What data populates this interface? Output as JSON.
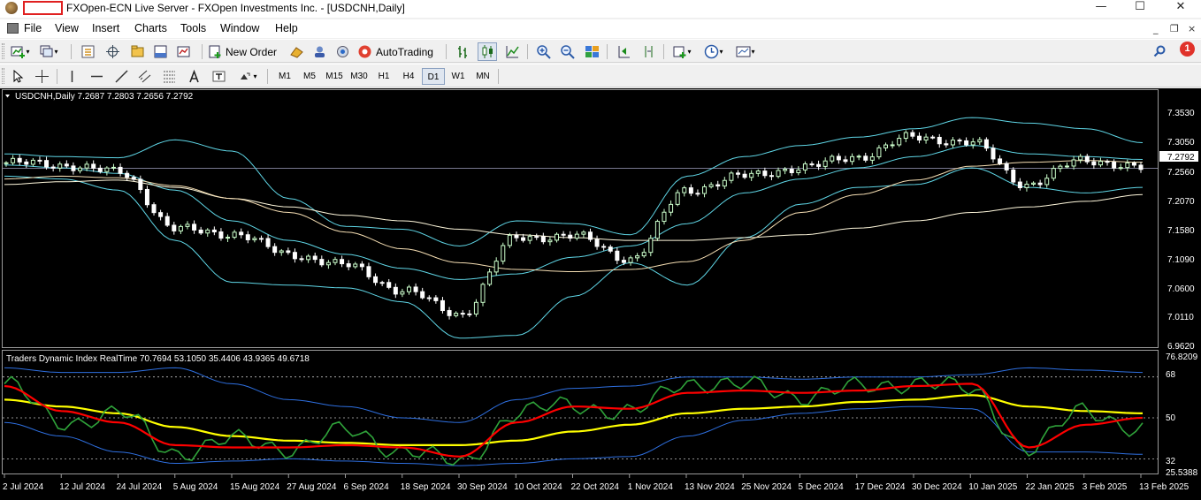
{
  "titlebar": {
    "title": "FXOpen-ECN Live Server - FXOpen Investments Inc. - [USDCNH,Daily]",
    "minimize": "—",
    "maximize": "☐",
    "close": "✕"
  },
  "menu": {
    "items": [
      "File",
      "View",
      "Insert",
      "Charts",
      "Tools",
      "Window",
      "Help"
    ],
    "mdi_minimize": "_",
    "mdi_restore": "❐",
    "mdi_close": "×"
  },
  "toolbar": {
    "new_order": "New Order",
    "auto_trading": "AutoTrading",
    "notification_count": "1"
  },
  "timeframes": [
    "M1",
    "M5",
    "M15",
    "M30",
    "H1",
    "H4",
    "D1",
    "W1",
    "MN"
  ],
  "active_timeframe": "D1",
  "colors": {
    "background": "#000000",
    "bull_candle": "#ccffcc",
    "bear_candle": "#ffffff",
    "bollinger": "#5fd6e6",
    "ma_long": "#fff8dc",
    "ma_mid": "#f5deb3",
    "tdi_green": "#2fa33a",
    "tdi_red": "#ff0000",
    "tdi_yellow": "#ffff00",
    "tdi_band": "#2e6fe0",
    "grid_level": "#bfbfbf"
  },
  "main_chart": {
    "header": "USDCNH,Daily  7.2687 7.2803 7.2656 7.2792",
    "current_price": "7.2792",
    "y_ticks": [
      "7.3530",
      "7.3050",
      "7.2560",
      "7.2070",
      "7.1580",
      "7.1090",
      "7.0600",
      "7.0110",
      "6.9620"
    ]
  },
  "indicator": {
    "header": "Traders Dynamic Index RealTime 70.7694 53.1050 35.4406 43.9365 49.6718",
    "y_ticks": [
      "76.8209",
      "68",
      "50",
      "32",
      "25.5388"
    ]
  },
  "x_axis": {
    "labels": [
      "2 Jul 2024",
      "12 Jul 2024",
      "24 Jul 2024",
      "5 Aug 2024",
      "15 Aug 2024",
      "27 Aug 2024",
      "6 Sep 2024",
      "18 Sep 2024",
      "30 Sep 2024",
      "10 Oct 2024",
      "22 Oct 2024",
      "1 Nov 2024",
      "13 Nov 2024",
      "25 Nov 2024",
      "5 Dec 2024",
      "17 Dec 2024",
      "30 Dec 2024",
      "10 Jan 2025",
      "22 Jan 2025",
      "3 Feb 2025",
      "13 Feb 2025"
    ]
  },
  "chart_data": [
    {
      "type": "candlestick",
      "title": "USDCNH,Daily",
      "ylim": [
        6.962,
        7.378
      ],
      "y_ticks": [
        7.353,
        7.305,
        7.256,
        7.207,
        7.158,
        7.109,
        7.06,
        7.011,
        6.962
      ],
      "last": {
        "open": 7.2687,
        "high": 7.2803,
        "low": 7.2656,
        "close": 7.2792
      },
      "x_labels": [
        "2 Jul 2024",
        "12 Jul 2024",
        "24 Jul 2024",
        "5 Aug 2024",
        "15 Aug 2024",
        "27 Aug 2024",
        "6 Sep 2024",
        "18 Sep 2024",
        "30 Sep 2024",
        "10 Oct 2024",
        "22 Oct 2024",
        "1 Nov 2024",
        "13 Nov 2024",
        "25 Nov 2024",
        "5 Dec 2024",
        "17 Dec 2024",
        "30 Dec 2024",
        "10 Jan 2025",
        "22 Jan 2025",
        "3 Feb 2025",
        "13 Feb 2025"
      ],
      "close_by_label": [
        7.289,
        7.285,
        7.272,
        7.17,
        7.162,
        7.125,
        7.105,
        7.06,
        7.018,
        7.155,
        7.158,
        7.117,
        7.24,
        7.265,
        7.28,
        7.3,
        7.335,
        7.325,
        7.25,
        7.295,
        7.279
      ],
      "series": [
        {
          "name": "Bollinger upper",
          "values": [
            7.305,
            7.3,
            7.298,
            7.33,
            7.31,
            7.225,
            7.175,
            7.17,
            7.14,
            7.185,
            7.18,
            7.16,
            7.265,
            7.3,
            7.32,
            7.335,
            7.35,
            7.37,
            7.36,
            7.35,
            7.325
          ]
        },
        {
          "name": "Bollinger middle",
          "values": [
            7.285,
            7.28,
            7.27,
            7.24,
            7.185,
            7.15,
            7.125,
            7.1,
            7.08,
            7.09,
            7.12,
            7.14,
            7.18,
            7.235,
            7.26,
            7.28,
            7.3,
            7.32,
            7.305,
            7.3,
            7.295
          ]
        },
        {
          "name": "Bollinger lower",
          "values": [
            7.265,
            7.26,
            7.24,
            7.15,
            7.075,
            7.07,
            7.065,
            7.04,
            6.975,
            6.98,
            7.05,
            7.11,
            7.07,
            7.155,
            7.215,
            7.245,
            7.25,
            7.28,
            7.245,
            7.235,
            7.245
          ]
        },
        {
          "name": "MA long",
          "values": [
            7.25,
            7.255,
            7.258,
            7.245,
            7.225,
            7.21,
            7.195,
            7.185,
            7.17,
            7.16,
            7.155,
            7.15,
            7.15,
            7.155,
            7.16,
            7.172,
            7.185,
            7.2,
            7.21,
            7.22,
            7.232
          ]
        },
        {
          "name": "MA mid",
          "values": [
            7.26,
            7.265,
            7.262,
            7.248,
            7.225,
            7.2,
            7.165,
            7.135,
            7.11,
            7.098,
            7.094,
            7.098,
            7.112,
            7.15,
            7.2,
            7.232,
            7.258,
            7.283,
            7.29,
            7.293,
            7.29
          ]
        }
      ]
    },
    {
      "type": "line",
      "title": "Traders Dynamic Index RealTime",
      "ylim": [
        25.5388,
        76.8209
      ],
      "y_ticks": [
        76.8209,
        68,
        50,
        32,
        25.5388
      ],
      "last_values": [
        70.7694,
        53.105,
        35.4406,
        43.9365,
        49.6718
      ],
      "x_labels": [
        "2 Jul 2024",
        "12 Jul 2024",
        "24 Jul 2024",
        "5 Aug 2024",
        "15 Aug 2024",
        "27 Aug 2024",
        "6 Sep 2024",
        "18 Sep 2024",
        "30 Sep 2024",
        "10 Oct 2024",
        "22 Oct 2024",
        "1 Nov 2024",
        "13 Nov 2024",
        "25 Nov 2024",
        "5 Dec 2024",
        "17 Dec 2024",
        "30 Dec 2024",
        "10 Jan 2025",
        "22 Jan 2025",
        "3 Feb 2025",
        "13 Feb 2025"
      ],
      "series": [
        {
          "name": "RSI",
          "values": [
            65,
            48,
            52,
            35,
            40,
            37,
            44,
            36,
            30,
            52,
            56,
            52,
            66,
            64,
            60,
            63,
            66,
            62,
            36,
            54,
            44
          ]
        },
        {
          "name": "Signal",
          "values": [
            64,
            53,
            48,
            38,
            37,
            37,
            38,
            37,
            33,
            48,
            55,
            54,
            61,
            62,
            61,
            62,
            64,
            65,
            37,
            47,
            50
          ]
        },
        {
          "name": "Market base",
          "values": [
            58,
            55,
            52,
            46,
            42,
            40,
            39,
            38,
            38,
            40,
            44,
            47,
            52,
            54,
            55,
            57,
            58,
            60,
            55,
            53,
            52
          ]
        },
        {
          "name": "Upper band",
          "values": [
            72,
            70,
            70,
            72,
            65,
            58,
            55,
            50,
            48,
            58,
            63,
            64,
            68,
            68,
            67,
            68,
            68,
            69,
            72,
            71,
            70
          ]
        },
        {
          "name": "Lower band",
          "values": [
            48,
            42,
            35,
            30,
            31,
            32,
            31,
            30,
            29,
            30,
            32,
            33,
            42,
            49,
            52,
            54,
            55,
            54,
            35,
            35,
            34
          ]
        }
      ]
    }
  ]
}
